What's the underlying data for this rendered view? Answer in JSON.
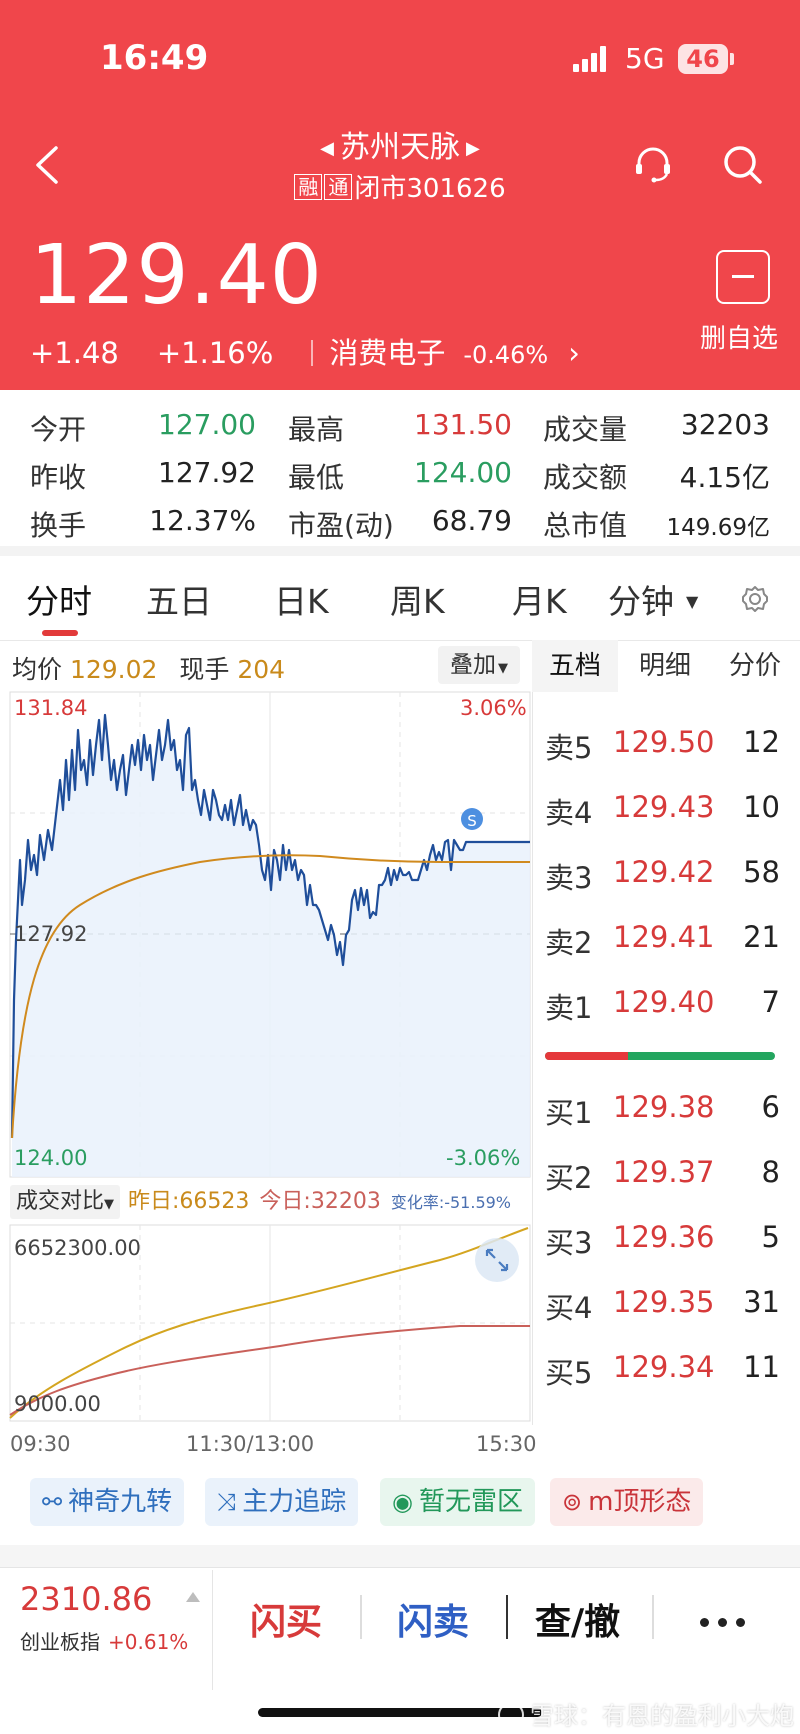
{
  "status": {
    "time": "16:49",
    "network": "5G",
    "battery": "46"
  },
  "header": {
    "stock_name": "苏州天脉",
    "tag_rong": "融",
    "tag_tong": "通",
    "market_status": "闭市",
    "code": "301626",
    "price": "129.40",
    "change": "+1.48",
    "change_pct": "+1.16%",
    "sector": "消费电子",
    "sector_change": "-0.46%",
    "remove_watchlist": "删自选"
  },
  "quote": {
    "open_label": "今开",
    "open": "127.00",
    "high_label": "最高",
    "high": "131.50",
    "volume_label": "成交量",
    "volume": "32203",
    "prev_close_label": "昨收",
    "prev_close": "127.92",
    "low_label": "最低",
    "low": "124.00",
    "amount_label": "成交额",
    "amount": "4.15亿",
    "turnover_label": "换手",
    "turnover": "12.37%",
    "pe_label": "市盈(动)",
    "pe": "68.79",
    "mcap_label": "总市值",
    "mcap": "149.69亿"
  },
  "tabs": [
    "分时",
    "五日",
    "日K",
    "周K",
    "月K",
    "分钟"
  ],
  "intraday": {
    "avg_label": "均价",
    "avg_price": "129.02",
    "last_vol_label": "现手",
    "last_vol": "204",
    "overlay_label": "叠加",
    "y_max": "131.84",
    "y_mid": "127.92",
    "y_min": "124.00",
    "pct_max": "3.06%",
    "pct_min": "-3.06%",
    "marker": "S"
  },
  "volume_compare": {
    "button": "成交对比",
    "yesterday": "昨日:66523",
    "today": "今日:32203",
    "change_rate": "变化率:-51.59%",
    "y_max": "6652300.00",
    "y_min": "9000.00"
  },
  "time_axis": {
    "start": "09:30",
    "mid": "11:30/13:00",
    "end": "15:30"
  },
  "order_book": {
    "tabs": [
      "五档",
      "明细",
      "分价"
    ],
    "asks": [
      {
        "label": "卖5",
        "price": "129.50",
        "vol": "12"
      },
      {
        "label": "卖4",
        "price": "129.43",
        "vol": "10"
      },
      {
        "label": "卖3",
        "price": "129.42",
        "vol": "58"
      },
      {
        "label": "卖2",
        "price": "129.41",
        "vol": "21"
      },
      {
        "label": "卖1",
        "price": "129.40",
        "vol": "7"
      }
    ],
    "bids": [
      {
        "label": "买1",
        "price": "129.38",
        "vol": "6"
      },
      {
        "label": "买2",
        "price": "129.37",
        "vol": "8"
      },
      {
        "label": "买3",
        "price": "129.36",
        "vol": "5"
      },
      {
        "label": "买4",
        "price": "129.35",
        "vol": "31"
      },
      {
        "label": "买5",
        "price": "129.34",
        "vol": "11"
      }
    ],
    "bid_ratio": 0.36
  },
  "features": [
    "神奇九转",
    "主力追踪",
    "暂无雷区",
    "m顶形态"
  ],
  "bottom": {
    "index_value": "2310.86",
    "index_name": "创业板指",
    "index_change": "+0.61%",
    "flash_buy": "闪买",
    "flash_sell": "闪卖",
    "query_cancel": "查/撤"
  },
  "watermark": "雪球：有恩的盈利小大炮",
  "colors": {
    "header_red": "#f0464b",
    "price_line": "#1f4e9a",
    "avg_line": "#d08a1e",
    "up_red": "#d73a3a",
    "down_green": "#2a9d60"
  }
}
